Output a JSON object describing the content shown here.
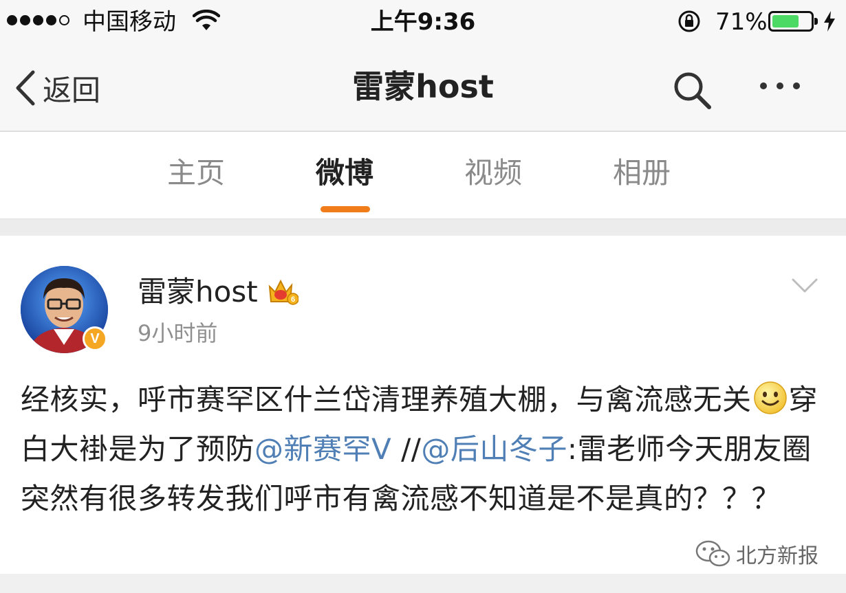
{
  "status_bar": {
    "carrier": "中国移动",
    "time": "上午9:36",
    "battery_percent_text": "71%",
    "battery_level": 0.71,
    "signal_bars_filled": 4,
    "signal_bars_total": 5,
    "battery_color": "#4cd964"
  },
  "nav": {
    "back_label": "返回",
    "title": "雷蒙host",
    "icons": [
      "chevron-left-icon",
      "search-icon",
      "more-icon"
    ]
  },
  "tabs": {
    "items": [
      {
        "label": "主页",
        "active": false
      },
      {
        "label": "微博",
        "active": true
      },
      {
        "label": "视频",
        "active": false
      },
      {
        "label": "相册",
        "active": false
      }
    ],
    "accent_color": "#f17c1a"
  },
  "post": {
    "author": "雷蒙host",
    "time": "9小时前",
    "verified_badge": "V",
    "crown_level": "6",
    "segments": {
      "s1": "经核实，呼市赛罕区什兰岱清理养殖大棚，与禽流感无关",
      "s2": "穿白大褂是为了预防",
      "mention1": "@新赛罕V",
      "s3": " //",
      "mention2": "@后山冬子",
      "s4": ":雷老师今天朋友圈突然有很多转发我们呼市有禽流感不知道是不是真的？？？"
    },
    "mention_color": "#4f7fb5"
  },
  "watermark": {
    "text": "北方新报"
  }
}
